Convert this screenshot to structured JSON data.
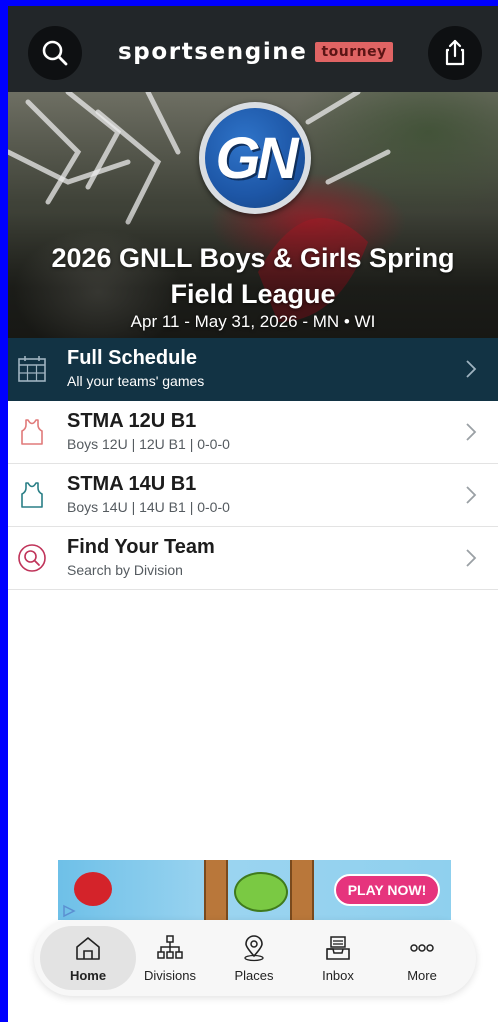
{
  "header": {
    "brand_word": "sportsengine",
    "brand_tag": "tourney"
  },
  "hero": {
    "logo_text": "GN",
    "title": "2026 GNLL Boys & Girls Spring Field League",
    "subtitle": "Apr 11 - May 31, 2026 - MN • WI"
  },
  "list": [
    {
      "title": "Full Schedule",
      "sub": "All your teams' games",
      "icon": "calendar-icon"
    },
    {
      "title": "STMA 12U B1",
      "sub": "Boys 12U | 12U B1 | 0-0-0",
      "icon": "jersey-icon",
      "icon_color": "#e07a7a"
    },
    {
      "title": "STMA 14U B1",
      "sub": "Boys 14U | 14U B1 | 0-0-0",
      "icon": "jersey-icon",
      "icon_color": "#2a7f86"
    },
    {
      "title": "Find Your Team",
      "sub": "Search by Division",
      "icon": "search-icon",
      "icon_color": "#c0345a"
    }
  ],
  "ad": {
    "cta": "PLAY NOW!"
  },
  "nav": [
    {
      "label": "Home",
      "icon": "home-icon"
    },
    {
      "label": "Divisions",
      "icon": "divisions-icon"
    },
    {
      "label": "Places",
      "icon": "location-pin-icon"
    },
    {
      "label": "Inbox",
      "icon": "inbox-icon"
    },
    {
      "label": "More",
      "icon": "more-icon"
    }
  ],
  "colors": {
    "header_bg": "#222629",
    "schedule_bg": "#123344",
    "brand_tag": "#e06464"
  }
}
